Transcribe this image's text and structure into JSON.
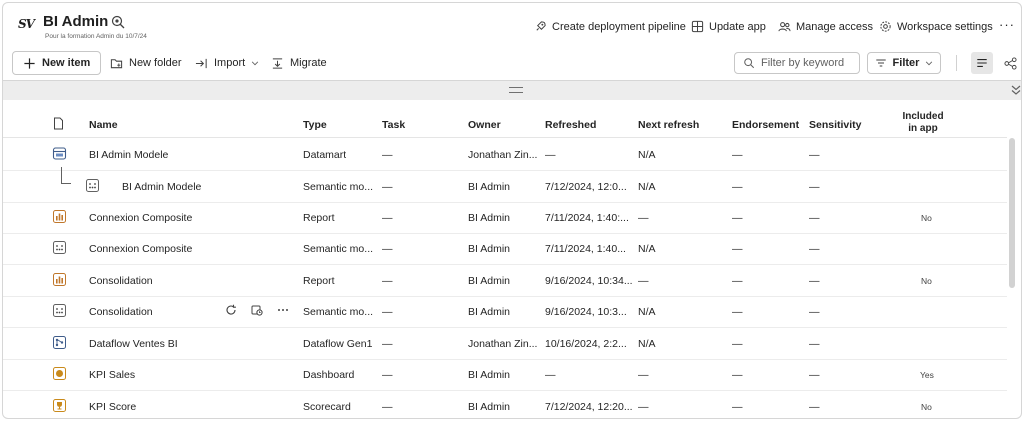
{
  "header": {
    "logo_text": "SV",
    "title": "BI Admin",
    "subtitle": "Pour la formation Admin du 10/7/24",
    "actions": [
      {
        "label": "Create deployment pipeline",
        "icon": "rocket-icon"
      },
      {
        "label": "Update app",
        "icon": "app-grid-icon"
      },
      {
        "label": "Manage access",
        "icon": "people-icon"
      },
      {
        "label": "Workspace settings",
        "icon": "gear-icon"
      }
    ],
    "more_label": "···"
  },
  "toolbar": {
    "new_item": "New item",
    "new_folder": "New folder",
    "import": "Import",
    "migrate": "Migrate",
    "filter_placeholder": "Filter by keyword",
    "filter_button": "Filter"
  },
  "table": {
    "columns": {
      "name": "Name",
      "type": "Type",
      "task": "Task",
      "owner": "Owner",
      "refreshed": "Refreshed",
      "next_refresh": "Next refresh",
      "endorsement": "Endorsement",
      "sensitivity": "Sensitivity",
      "included_line1": "Included",
      "included_line2": "in app"
    },
    "rows": [
      {
        "name": "BI Admin Modele",
        "type": "Datamart",
        "task": "—",
        "owner": "Jonathan Zin...",
        "refreshed": "—",
        "next_refresh": "N/A",
        "endorsement": "—",
        "sensitivity": "—",
        "included": "",
        "icon": "datamart-icon"
      },
      {
        "name": "BI Admin Modele",
        "type": "Semantic mo...",
        "task": "—",
        "owner": "BI Admin",
        "refreshed": "7/12/2024, 12:0...",
        "next_refresh": "N/A",
        "endorsement": "—",
        "sensitivity": "—",
        "included": "",
        "icon": "semantic-model-icon"
      },
      {
        "name": "Connexion Composite",
        "type": "Report",
        "task": "—",
        "owner": "BI Admin",
        "refreshed": "7/11/2024, 1:40:...",
        "next_refresh": "—",
        "endorsement": "—",
        "sensitivity": "—",
        "included": "No",
        "icon": "report-icon"
      },
      {
        "name": "Connexion Composite",
        "type": "Semantic mo...",
        "task": "—",
        "owner": "BI Admin",
        "refreshed": "7/11/2024, 1:40...",
        "next_refresh": "N/A",
        "endorsement": "—",
        "sensitivity": "—",
        "included": "",
        "icon": "semantic-model-icon"
      },
      {
        "name": "Consolidation",
        "type": "Report",
        "task": "—",
        "owner": "BI Admin",
        "refreshed": "9/16/2024, 10:34...",
        "next_refresh": "—",
        "endorsement": "—",
        "sensitivity": "—",
        "included": "No",
        "icon": "report-icon"
      },
      {
        "name": "Consolidation",
        "type": "Semantic mo...",
        "task": "—",
        "owner": "BI Admin",
        "refreshed": "9/16/2024, 10:3...",
        "next_refresh": "N/A",
        "endorsement": "—",
        "sensitivity": "—",
        "included": "",
        "icon": "semantic-model-icon"
      },
      {
        "name": "Dataflow Ventes BI",
        "type": "Dataflow Gen1",
        "task": "—",
        "owner": "Jonathan Zin...",
        "refreshed": "10/16/2024, 2:2...",
        "next_refresh": "N/A",
        "endorsement": "—",
        "sensitivity": "—",
        "included": "",
        "icon": "dataflow-icon"
      },
      {
        "name": "KPI Sales",
        "type": "Dashboard",
        "task": "—",
        "owner": "BI Admin",
        "refreshed": "—",
        "next_refresh": "—",
        "endorsement": "—",
        "sensitivity": "—",
        "included": "Yes",
        "icon": "dashboard-icon"
      },
      {
        "name": "KPI Score",
        "type": "Scorecard",
        "task": "—",
        "owner": "BI Admin",
        "refreshed": "7/12/2024, 12:20...",
        "next_refresh": "—",
        "endorsement": "—",
        "sensitivity": "—",
        "included": "No",
        "icon": "scorecard-icon"
      }
    ]
  },
  "colors": {
    "report_icon": "#c0772b",
    "dashboard_icon": "#c98a1b",
    "border": "#c7c7c7"
  }
}
